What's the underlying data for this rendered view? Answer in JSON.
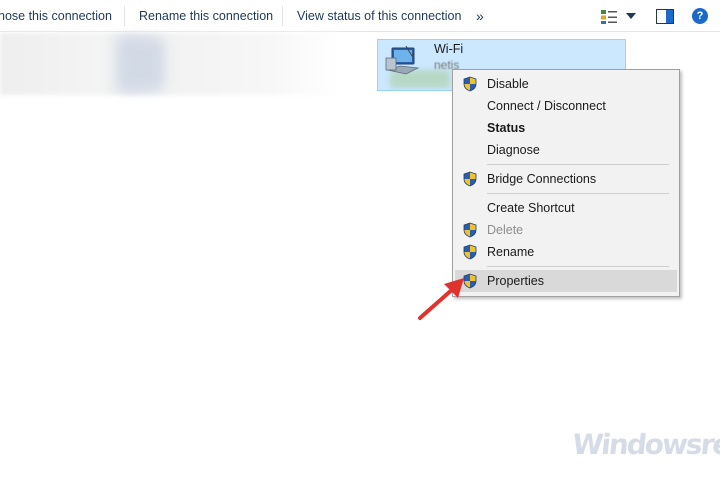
{
  "toolbar": {
    "items": [
      {
        "label": "nose this connection"
      },
      {
        "label": "Rename this connection"
      },
      {
        "label": "View status of this connection"
      }
    ],
    "more_glyph": "»",
    "view_icon": "change-view-icon",
    "preview_icon": "preview-pane-icon",
    "help_glyph": "?"
  },
  "connection": {
    "name": "Wi-Fi",
    "network": "netis",
    "icon": "network-adapter-icon"
  },
  "context_menu": {
    "items": [
      {
        "label": "Disable",
        "icon": "uac-shield-icon"
      },
      {
        "label": "Connect / Disconnect"
      },
      {
        "label": "Status",
        "bold": true
      },
      {
        "label": "Diagnose"
      },
      {
        "label": "Bridge Connections",
        "icon": "uac-shield-icon"
      },
      {
        "label": "Create Shortcut"
      },
      {
        "label": "Delete",
        "icon": "uac-shield-icon",
        "disabled": true
      },
      {
        "label": "Rename",
        "icon": "uac-shield-icon"
      },
      {
        "label": "Properties",
        "icon": "uac-shield-icon",
        "highlighted": true
      }
    ]
  },
  "watermark": "Windowsreport",
  "colors": {
    "selection_bg": "#cce8ff",
    "selection_border": "#99d1ff",
    "menu_bg": "#f2f2f2",
    "menu_highlight": "#d9d9d9",
    "arrow": "#e0332e",
    "toolbar_text": "#1e3957"
  }
}
